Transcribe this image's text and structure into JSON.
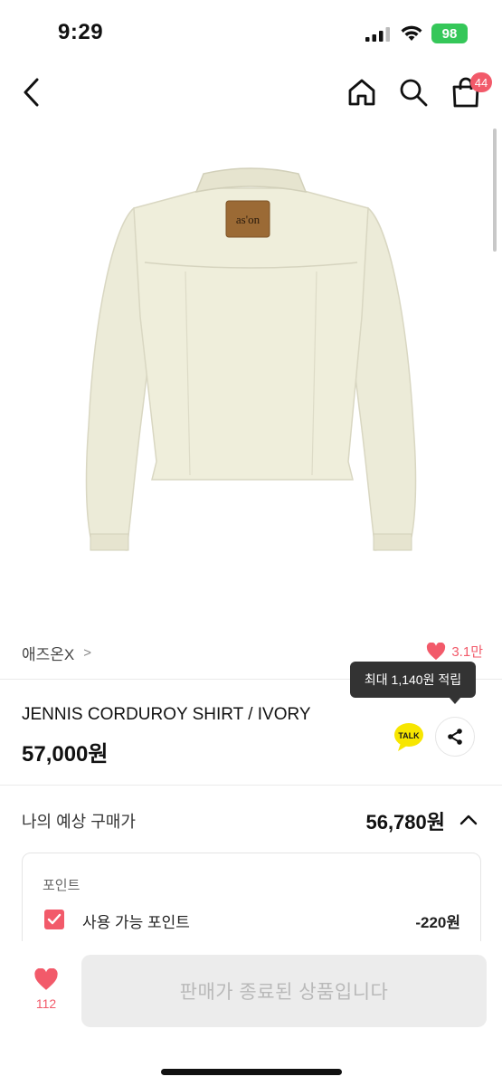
{
  "status_bar": {
    "time": "9:29",
    "battery": "98"
  },
  "nav": {
    "back_icon": "chevron-left-icon",
    "home_icon": "home-icon",
    "search_icon": "search-icon",
    "cart_icon": "shopping-bag-icon",
    "cart_count": "44"
  },
  "product": {
    "image_label": "as'on",
    "brand": "애즈온X",
    "likes": "3.1만",
    "title": "JENNIS CORDUROY SHIRT / IVORY",
    "price": "57,000원",
    "reward_tooltip": "최대 1,140원 적립",
    "talk_label": "TALK"
  },
  "expected_price": {
    "label": "나의 예상 구매가",
    "value": "56,780원"
  },
  "points": {
    "title": "포인트",
    "option_label": "사용 가능 포인트",
    "option_value": "-220원",
    "checked": true
  },
  "bottom": {
    "wish_count": "112",
    "sold_out_label": "판매가 종료된 상품입니다"
  },
  "colors": {
    "accent": "#f25a6a",
    "battery": "#35c759",
    "jacket": "#ecebd8",
    "kakao": "#f7e600"
  }
}
